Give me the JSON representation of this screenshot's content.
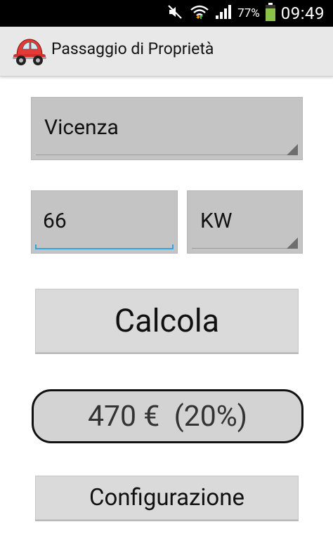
{
  "status_bar": {
    "battery_percent": "77%",
    "time": "09:49",
    "icons": [
      "mute-icon",
      "wifi-icon",
      "signal-icon",
      "battery-icon"
    ]
  },
  "app_bar": {
    "title": "Passaggio di Proprietà",
    "icon": "car-icon"
  },
  "form": {
    "province": {
      "selected": "Vicenza"
    },
    "power": {
      "value": "66"
    },
    "unit": {
      "selected": "KW"
    }
  },
  "buttons": {
    "calculate": "Calcola",
    "config": "Configurazione"
  },
  "result": {
    "text": "470 €  (20%)"
  },
  "colors": {
    "accent": "#33a3dc",
    "car_red": "#e53935",
    "appbar_bg": "#e8e8e8"
  }
}
